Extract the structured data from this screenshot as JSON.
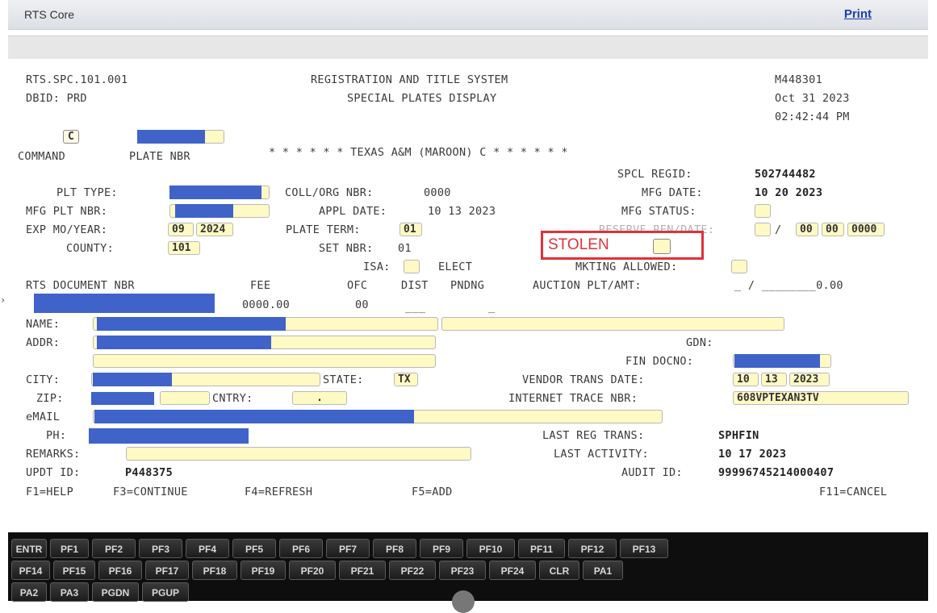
{
  "window": {
    "title": "RTS Core",
    "print_label": "Print"
  },
  "header": {
    "program": "RTS.SPC.101.001",
    "dbid": "DBID: PRD",
    "system": "REGISTRATION AND TITLE SYSTEM",
    "screen": "SPECIAL PLATES DISPLAY",
    "user_code": "M448301",
    "date": "Oct 31 2023",
    "time": "02:42:44 PM"
  },
  "command": {
    "value": "C",
    "command_label": "COMMAND",
    "plate_label": "PLATE NBR"
  },
  "banner": "* * * * * * TEXAS A&M (MAROON) C * * * * * *",
  "fields": {
    "spcl_regid_label": "SPCL REGID:",
    "spcl_regid": "502744482",
    "plt_type_label": "PLT TYPE:",
    "coll_org_label": "COLL/ORG NBR:",
    "coll_org": "0000",
    "mfg_date_label": "MFG DATE:",
    "mfg_date": "10 20 2023",
    "mfg_plt_label": "MFG PLT NBR:",
    "appl_date_label": "APPL DATE:",
    "appl_date": "10 13 2023",
    "mfg_status_label": "MFG STATUS:",
    "exp_label": "EXP MO/YEAR:",
    "exp_mo": "09",
    "exp_year": "2024",
    "plate_term_label": "PLATE TERM:",
    "plate_term": "01",
    "reserve_label": "RESERVE REN/DATE:",
    "reserve_slash": "/",
    "reserve_mm": "00",
    "reserve_dd": "00",
    "reserve_yyyy": "0000",
    "county_label": "COUNTY:",
    "county": "101",
    "set_nbr_label": "SET NBR:",
    "set_nbr": "01",
    "stolen_label": "STOLEN",
    "isa_label": "ISA:",
    "elect_label": "ELECT",
    "mkting_label": "MKTING ALLOWED:"
  },
  "doc_row": {
    "headers": [
      "RTS DOCUMENT NBR",
      "FEE",
      "OFC",
      "DIST",
      "PNDNG",
      "AUCTION PLT/AMT:"
    ],
    "auction_value": "_ / ________0.00",
    "fee": "0000.00",
    "ofc": "00",
    "dist": "___",
    "pndng": "_"
  },
  "owner": {
    "name_label": "NAME:",
    "addr_label": "ADDR:",
    "gdn_label": "GDN:",
    "fin_docno_label": "FIN DOCNO:",
    "city_label": "CITY:",
    "state_label": "STATE:",
    "state": "TX",
    "vendor_label": "VENDOR TRANS DATE:",
    "vendor_mm": "10",
    "vendor_dd": "13",
    "vendor_yyyy": "2023",
    "zip_label": "ZIP:",
    "cntry_label": "CNTRY:",
    "cntry": ".",
    "trace_label": "INTERNET TRACE NBR:",
    "trace": "608VPTEXAN3TV",
    "email_label": "eMAIL",
    "ph_label": "PH:",
    "last_reg_label": "LAST REG TRANS:",
    "last_reg": "SPHFIN",
    "remarks_label": "REMARKS:",
    "last_activity_label": "LAST ACTIVITY:",
    "last_activity": "10 17 2023",
    "updt_label": "UPDT ID:",
    "updt": "P448375",
    "audit_label": "AUDIT ID:",
    "audit": "99996745214000407"
  },
  "function_keys": [
    "F1=HELP",
    "F3=CONTINUE",
    "F4=REFRESH",
    "F5=ADD",
    "F11=CANCEL"
  ],
  "keypad": {
    "row1": [
      "ENTR",
      "PF1",
      "PF2",
      "PF3",
      "PF4",
      "PF5",
      "PF6",
      "PF7",
      "PF8",
      "PF9",
      "PF10",
      "PF11",
      "PF12",
      "PF13"
    ],
    "row2": [
      "PF14",
      "PF15",
      "PF16",
      "PF17",
      "PF18",
      "PF19",
      "PF20",
      "PF21",
      "PF22",
      "PF23",
      "PF24",
      "CLR",
      "PA1"
    ],
    "row3": [
      "PA2",
      "PA3",
      "PGDN",
      "PGUP"
    ]
  },
  "colors": {
    "redaction": "#3f63c9",
    "field_bg": "#fff9c4",
    "highlight": "#e0313b"
  }
}
